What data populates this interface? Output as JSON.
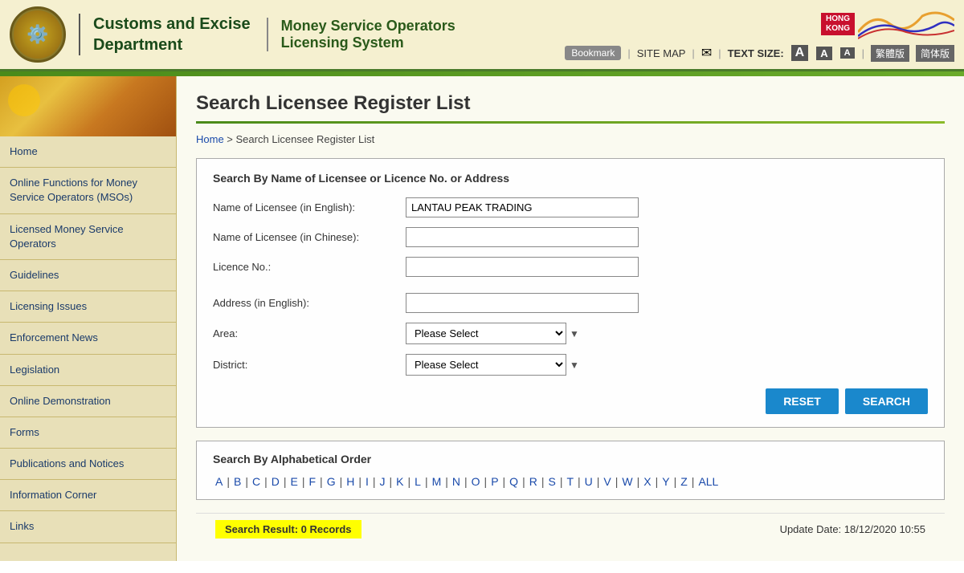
{
  "header": {
    "dept_line1": "Customs and Excise",
    "dept_line2": "Department",
    "system_line1": "Money Service Operators",
    "system_line2": "Licensing System",
    "hk_badge_line1": "HONG",
    "hk_badge_line2": "KONG",
    "toolbar": {
      "bookmark": "Bookmark",
      "sitemap": "SITE MAP",
      "textsize_label": "TEXT SIZE:",
      "lang1": "繁體版",
      "lang2": "简体版"
    }
  },
  "sidebar": {
    "items": [
      {
        "id": "home",
        "label": "Home"
      },
      {
        "id": "online-functions",
        "label": "Online Functions for Money Service Operators (MSOs)"
      },
      {
        "id": "licensed-mso",
        "label": "Licensed Money Service Operators"
      },
      {
        "id": "guidelines",
        "label": "Guidelines"
      },
      {
        "id": "licensing-issues",
        "label": "Licensing Issues"
      },
      {
        "id": "enforcement-news",
        "label": "Enforcement News"
      },
      {
        "id": "legislation",
        "label": "Legislation"
      },
      {
        "id": "online-demo",
        "label": "Online Demonstration"
      },
      {
        "id": "forms",
        "label": "Forms"
      },
      {
        "id": "publications",
        "label": "Publications and Notices"
      },
      {
        "id": "info-corner",
        "label": "Information Corner"
      },
      {
        "id": "links",
        "label": "Links"
      }
    ]
  },
  "page": {
    "title": "Search Licensee Register List",
    "breadcrumb_home": "Home",
    "breadcrumb_sep": " > ",
    "breadcrumb_current": "Search Licensee Register List"
  },
  "search_form": {
    "section_title": "Search By Name of Licensee or Licence No. or Address",
    "field_name_en_label": "Name of Licensee (in English):",
    "field_name_en_value": "LANTAU PEAK TRADING",
    "field_name_zh_label": "Name of Licensee (in Chinese):",
    "field_name_zh_value": "",
    "field_licence_label": "Licence No.:",
    "field_licence_value": "",
    "field_address_label": "Address (in English):",
    "field_address_value": "",
    "field_area_label": "Area:",
    "field_area_placeholder": "Please Select",
    "field_district_label": "District:",
    "field_district_placeholder": "Please Select",
    "btn_reset": "RESET",
    "btn_search": "SEARCH"
  },
  "alpha_search": {
    "section_title": "Search By Alphabetical Order",
    "letters": [
      "A",
      "B",
      "C",
      "D",
      "E",
      "F",
      "G",
      "H",
      "I",
      "J",
      "K",
      "L",
      "M",
      "N",
      "O",
      "P",
      "Q",
      "R",
      "S",
      "T",
      "U",
      "V",
      "W",
      "X",
      "Y",
      "Z",
      "ALL"
    ]
  },
  "footer": {
    "result_label": "Search Result: 0 Records",
    "update_date": "Update Date: 18/12/2020 10:55"
  }
}
